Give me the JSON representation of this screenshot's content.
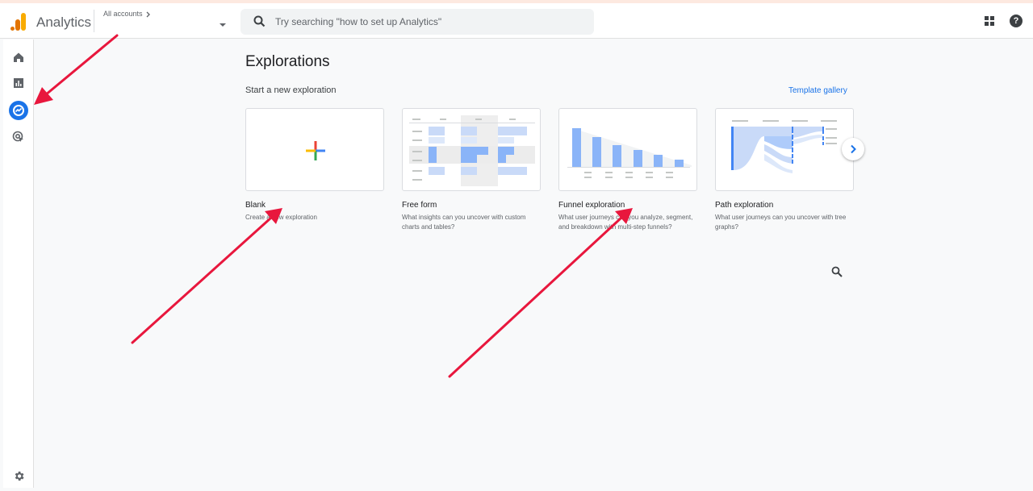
{
  "header": {
    "app_name": "Analytics",
    "accounts_breadcrumb": "All accounts",
    "search_placeholder": "Try searching \"how to set up Analytics\"",
    "help_glyph": "?",
    "icons": [
      "analytics-logo-icon",
      "search-icon",
      "apps-grid-icon",
      "help-icon",
      "chevron-right-icon",
      "caret-down-icon"
    ]
  },
  "sidebar": {
    "items": [
      {
        "name": "home-icon"
      },
      {
        "name": "reports-icon"
      },
      {
        "name": "explore-icon",
        "active": true
      },
      {
        "name": "advertising-icon"
      }
    ],
    "settings": "settings-gear-icon"
  },
  "main": {
    "title": "Explorations",
    "subtitle": "Start a new exploration",
    "template_gallery": "Template gallery",
    "cards": [
      {
        "title": "Blank",
        "description": "Create a new exploration"
      },
      {
        "title": "Free form",
        "description": "What insights can you uncover with custom charts and tables?"
      },
      {
        "title": "Funnel exploration",
        "description": "What user journeys can you analyze, segment, and breakdown with multi-step funnels?"
      },
      {
        "title": "Path exploration",
        "description": "What user journeys can you uncover with tree graphs?"
      }
    ]
  },
  "colors": {
    "accent_blue": "#1a73e8",
    "annotation_arrow": "#e8173d",
    "logo_orange": "#f9ab00",
    "logo_dark_orange": "#e37400"
  }
}
